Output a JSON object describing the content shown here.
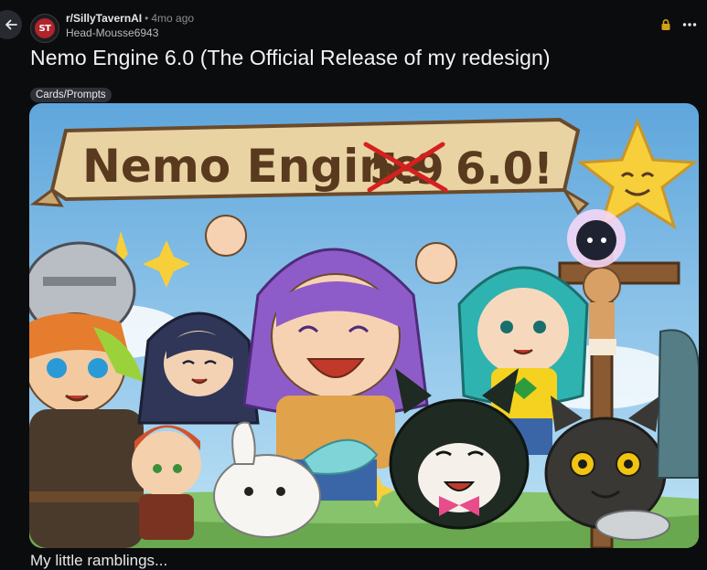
{
  "header": {
    "subreddit": "r/SillyTavernAI",
    "separator": "•",
    "time": "4mo ago",
    "author": "Head-Mousse6943",
    "avatar_text": "ST"
  },
  "post": {
    "title": "Nemo Engine 6.0 (The Official Release of my redesign)",
    "flair": "Cards/Prompts",
    "body_preview": "My little ramblings..."
  },
  "image": {
    "banner_text": "Nemo Engine",
    "struck_version": "5.9",
    "new_version": "6.0!"
  },
  "icons": {
    "back": "arrow-left-icon",
    "lock": "lock-icon",
    "more": "more-horizontal-icon"
  },
  "colors": {
    "background": "#0b0c0e",
    "lock": "#d4a017",
    "strike": "#d62020"
  }
}
